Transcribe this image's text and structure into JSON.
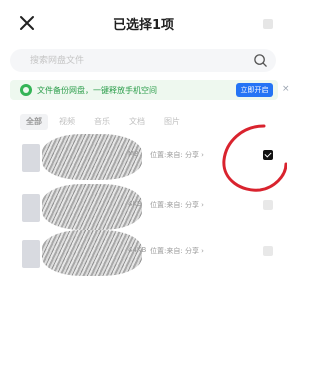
{
  "header": {
    "title": "已选择1项",
    "close_icon": "close-icon"
  },
  "search": {
    "placeholder": "搜索网盘文件",
    "icon": "search-icon"
  },
  "banner": {
    "text": "文件备份网盘，一键释放手机空间",
    "button_label": "立即开启",
    "close_label": "×",
    "accent": "#34b456",
    "button_color": "#2474f5"
  },
  "filters": [
    {
      "label": "全部",
      "active": true
    },
    {
      "label": "视频",
      "active": false
    },
    {
      "label": "音乐",
      "active": false
    },
    {
      "label": "文档",
      "active": false
    },
    {
      "label": "图片",
      "active": false
    }
  ],
  "files": [
    {
      "size": "MB",
      "meta": "位置:来自: 分享 ›",
      "selected": true
    },
    {
      "size": "4KB",
      "meta": "位置:来自: 分享 ›",
      "selected": false
    },
    {
      "size": "44KB",
      "meta": "位置:来自: 分享 ›",
      "selected": false
    }
  ],
  "annotation": {
    "color": "#d9232e"
  }
}
